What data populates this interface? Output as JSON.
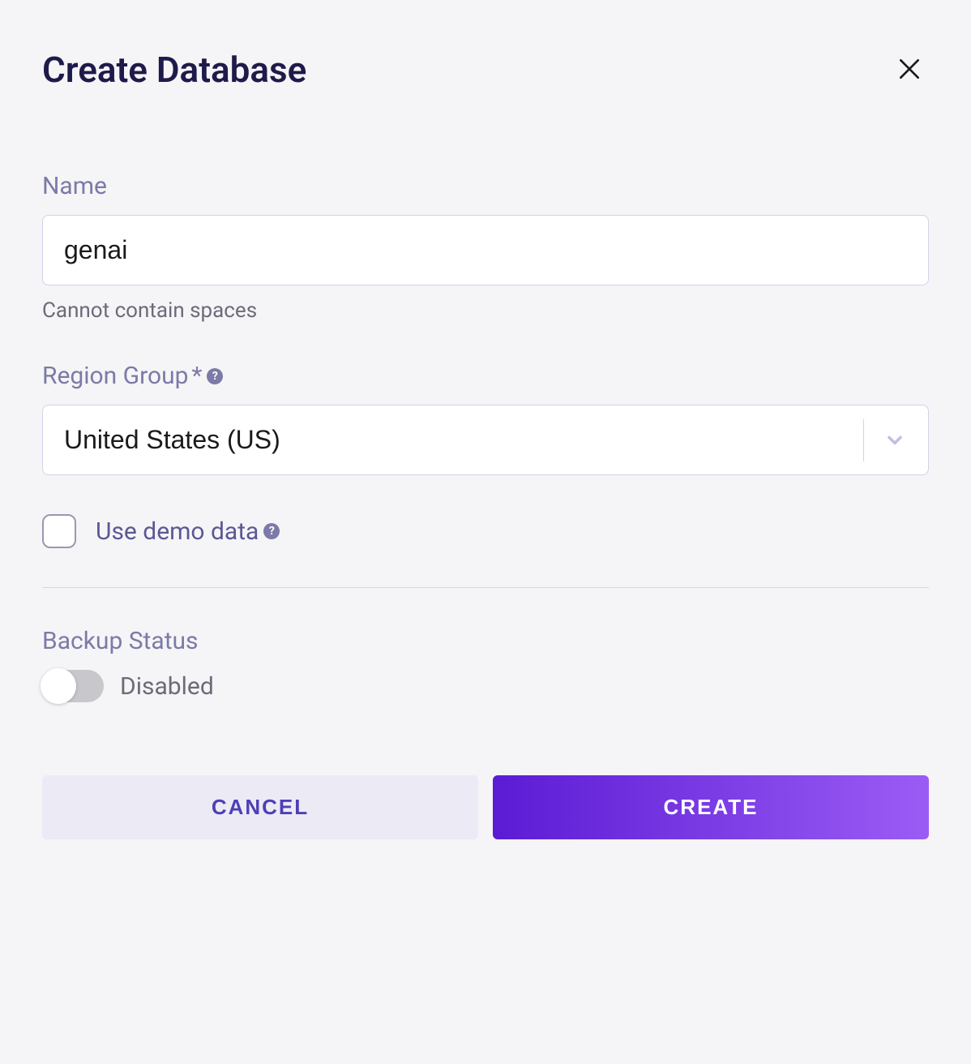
{
  "modal": {
    "title": "Create Database"
  },
  "fields": {
    "name": {
      "label": "Name",
      "value": "genai",
      "helper": "Cannot contain spaces"
    },
    "region": {
      "label": "Region Group",
      "required_mark": "*",
      "value": "United States (US)"
    },
    "demo": {
      "label": "Use demo data"
    },
    "backup": {
      "label": "Backup Status",
      "state_label": "Disabled"
    }
  },
  "buttons": {
    "cancel": "CANCEL",
    "create": "CREATE"
  }
}
